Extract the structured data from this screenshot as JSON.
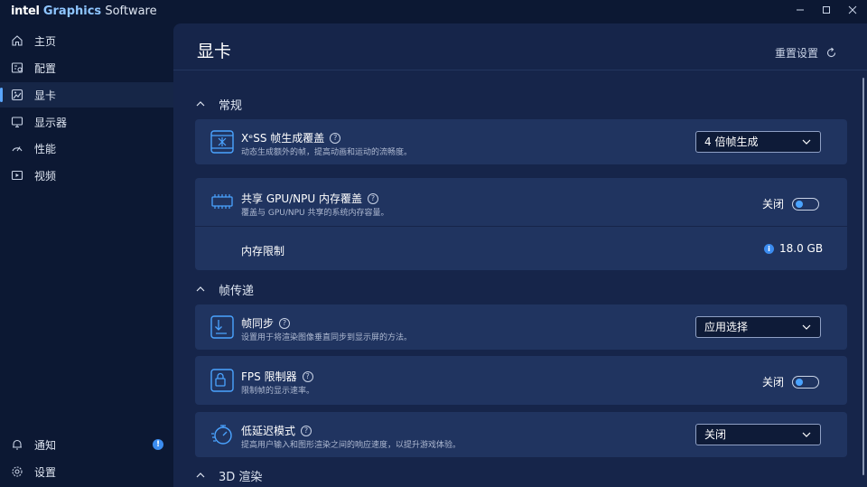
{
  "app": {
    "brand_intel": "intel",
    "brand_graphics": "Graphics",
    "brand_software": "Software"
  },
  "window_controls": {
    "minimize": "–",
    "maximize": "□",
    "close": "✕"
  },
  "sidebar": {
    "items": [
      {
        "label": "主页",
        "icon": "home-icon"
      },
      {
        "label": "配置",
        "icon": "profile-icon"
      },
      {
        "label": "显卡",
        "icon": "graphics-icon",
        "active": true
      },
      {
        "label": "显示器",
        "icon": "monitor-icon"
      },
      {
        "label": "性能",
        "icon": "gauge-icon"
      },
      {
        "label": "视频",
        "icon": "video-icon"
      }
    ],
    "bottom": [
      {
        "label": "通知",
        "icon": "bell-icon",
        "badge": "!"
      },
      {
        "label": "设置",
        "icon": "gear-icon"
      }
    ]
  },
  "header": {
    "title": "显卡",
    "reset_label": "重置设置"
  },
  "sections": {
    "general": {
      "label": "常规"
    },
    "frame_delivery": {
      "label": "帧传递"
    },
    "rendering_3d": {
      "label": "3D 渲染"
    }
  },
  "rows": {
    "xess": {
      "title": "XᵉSS 帧生成覆盖",
      "desc": "动态生成额外的帧，提高动画和运动的流畅度。",
      "value": "4 倍帧生成"
    },
    "shared_mem": {
      "title": "共享 GPU/NPU 内存覆盖",
      "desc": "覆盖与 GPU/NPU 共享的系统内存容量。",
      "toggle_label": "关闭"
    },
    "mem_limit": {
      "title": "内存限制",
      "value": "18.0 GB"
    },
    "vsync": {
      "title": "帧同步",
      "desc": "设置用于将渲染图像垂直同步到显示屏的方法。",
      "value": "应用选择"
    },
    "fps_limiter": {
      "title": "FPS 限制器",
      "desc": "限制帧的显示速率。",
      "toggle_label": "关闭"
    },
    "low_latency": {
      "title": "低延迟模式",
      "desc": "提高用户输入和图形渲染之间的响应速度，以提升游戏体验。",
      "value": "关闭"
    }
  },
  "help_glyph": "?",
  "info_glyph": "i",
  "colors": {
    "accent": "#4aa3ff",
    "background": "#0c1833",
    "panel": "#16254a",
    "card": "#203460"
  }
}
